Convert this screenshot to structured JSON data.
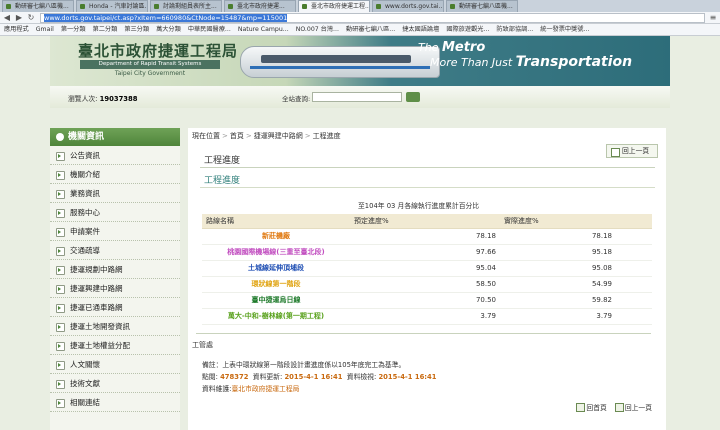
{
  "browser": {
    "tabs": [
      {
        "label": "動研審七編八區機..."
      },
      {
        "label": "Honda - 汽車討論區..."
      },
      {
        "label": "討論剩組員表所主..."
      },
      {
        "label": "臺北市政府捷運..."
      },
      {
        "label": "臺北市政府捷運工程..."
      },
      {
        "label": "www.dorts.gov.tai..."
      },
      {
        "label": "動研審七編八區機..."
      }
    ],
    "active_tab": 4,
    "url_selected": "www.dorts.gov.taipei/ct.asp?xItem=660980&CtNode=15487&mp=115001",
    "bookmarks": [
      {
        "label": "應用程式"
      },
      {
        "label": "Gmail"
      },
      {
        "label": "第一分類"
      },
      {
        "label": "第二分類"
      },
      {
        "label": "第三分類"
      },
      {
        "label": "萬大分類"
      },
      {
        "label": "中華民國醫療..."
      },
      {
        "label": "Nature Campu..."
      },
      {
        "label": "NO.007 台灣..."
      },
      {
        "label": "動研審七編八區..."
      },
      {
        "label": "捷太國語論壇"
      },
      {
        "label": "國際旅遊觀光..."
      },
      {
        "label": "防致部協調..."
      },
      {
        "label": "統一發票中獎號..."
      }
    ]
  },
  "banner": {
    "org_cn": "臺北市政府捷運工程局",
    "org_en": "Department of Rapid Transit Systems",
    "org_en2": "Taipei City Government",
    "slogan_a": "The",
    "slogan_b": "Metro",
    "slogan_c": "More Than Just",
    "slogan_d": "Transportation"
  },
  "toolbar": {
    "visitor_label": "瀏覽人次:",
    "visitor_count": "19037388",
    "search_label": "全站查詢:"
  },
  "sidebar": {
    "heading": "機關資訊",
    "items": [
      {
        "label": "公告資訊"
      },
      {
        "label": "機關介紹"
      },
      {
        "label": "業務資訊"
      },
      {
        "label": "服務中心"
      },
      {
        "label": "申請案件"
      },
      {
        "label": "交通疏導"
      },
      {
        "label": "捷運規劃中路網"
      },
      {
        "label": "捷運興建中路網"
      },
      {
        "label": "捷運已通車路網"
      },
      {
        "label": "捷運土地開發資訊"
      },
      {
        "label": "捷運土地權益分配"
      },
      {
        "label": "人文關懷"
      },
      {
        "label": "技術文獻"
      },
      {
        "label": "相關連結"
      }
    ]
  },
  "main": {
    "breadcrumb_prefix": "現在位置",
    "breadcrumb": [
      "首頁",
      "捷運興建中路網",
      "工程進度"
    ],
    "back_label": "回上一頁",
    "title": "工程進度",
    "subtitle": "工程進度",
    "caption": "至104年 03 月各線執行進度累計百分比",
    "table": {
      "headers": [
        "路線名稱",
        "預定進度%",
        "實際進度%"
      ],
      "rows": [
        {
          "name": "新莊機廠",
          "planned": "78.18",
          "actual": "78.18",
          "color": "#e07a12"
        },
        {
          "name": "桃園國際機場線(三重至臺北段)",
          "planned": "97.66",
          "actual": "95.18",
          "color": "#c24fc0"
        },
        {
          "name": "土城線延伸頂埔段",
          "planned": "95.04",
          "actual": "95.08",
          "color": "#1f4fb4"
        },
        {
          "name": "環狀線第一階段",
          "planned": "58.50",
          "actual": "54.99",
          "color": "#e0a412"
        },
        {
          "name": "臺中捷運烏日線",
          "planned": "70.50",
          "actual": "59.82",
          "color": "#1e7a2a"
        },
        {
          "name": "萬大-中和-樹林線(第一期工程)",
          "planned": "3.79",
          "actual": "3.79",
          "color": "#5aa21e"
        }
      ]
    },
    "engineer_label": "工管處",
    "note": "備註：上表中環狀線第一階段設計畫進度係以105年底完工為基準。",
    "clicks_label": "點閱:",
    "clicks": "478372",
    "updated_label": "資料更新:",
    "updated": "2015-4-1 16:41",
    "checked_label": "資料檢視:",
    "checked": "2015-4-1 16:41",
    "source_label": "資料維護:",
    "source": "臺北市政府捷運工程局",
    "bottom_links": [
      {
        "label": "回首頁"
      },
      {
        "label": "回上一頁"
      }
    ]
  }
}
